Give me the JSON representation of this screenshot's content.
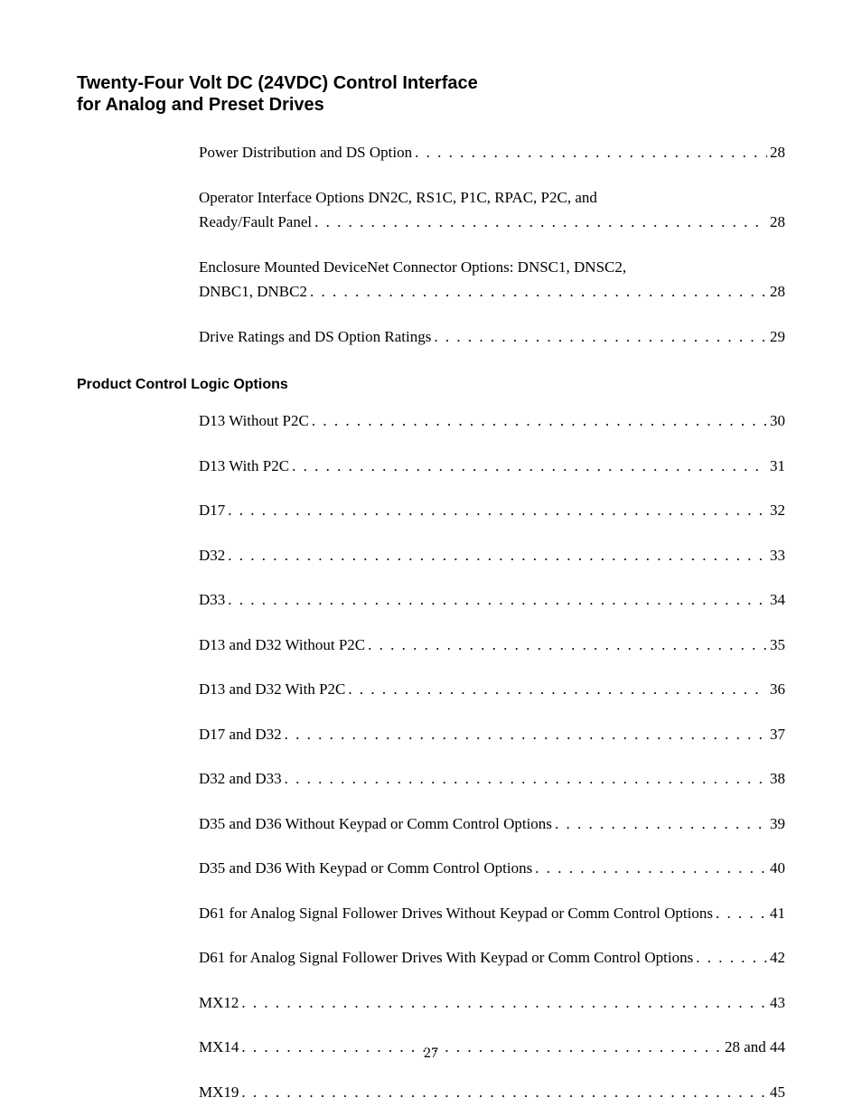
{
  "title_line1": "Twenty-Four Volt DC (24VDC) Control Interface",
  "title_line2": "for Analog and Preset Drives",
  "page_number": "27",
  "section_heading": "Product Control Logic Options",
  "group1": [
    {
      "prefix": "",
      "label": "Power Distribution and DS Option",
      "page": "28"
    },
    {
      "prefix": "Operator Interface Options DN2C, RS1C, P1C, RPAC, P2C, and",
      "label": "Ready/Fault Panel",
      "page": "28"
    },
    {
      "prefix": "Enclosure Mounted DeviceNet Connector Options: DNSC1, DNSC2,",
      "label": "DNBC1, DNBC2",
      "page": "28"
    },
    {
      "prefix": "",
      "label": "Drive Ratings and DS Option Ratings",
      "page": "29"
    }
  ],
  "group2": [
    {
      "label": "D13 Without P2C",
      "page": "30"
    },
    {
      "label": "D13 With P2C",
      "page": "31"
    },
    {
      "label": "D17",
      "page": "32"
    },
    {
      "label": "D32",
      "page": "33"
    },
    {
      "label": "D33",
      "page": "34"
    },
    {
      "label": "D13 and D32 Without P2C",
      "page": "35"
    },
    {
      "label": "D13 and D32 With P2C",
      "page": "36"
    },
    {
      "label": "D17 and D32",
      "page": "37"
    },
    {
      "label": "D32 and D33",
      "page": "38"
    },
    {
      "label": "D35 and D36 Without Keypad or Comm Control Options",
      "page": "39"
    },
    {
      "label": "D35 and D36 With Keypad or Comm Control Options",
      "page": "40"
    },
    {
      "label": "D61 for Analog Signal Follower Drives Without Keypad or Comm Control Options",
      "page": "41"
    },
    {
      "label": "D61 for Analog Signal Follower Drives With Keypad or Comm Control Options",
      "page": "42"
    },
    {
      "label": "MX12",
      "page": "43"
    },
    {
      "label": "MX14",
      "page": "28 and 44"
    },
    {
      "label": "MX19",
      "page": "45"
    }
  ]
}
